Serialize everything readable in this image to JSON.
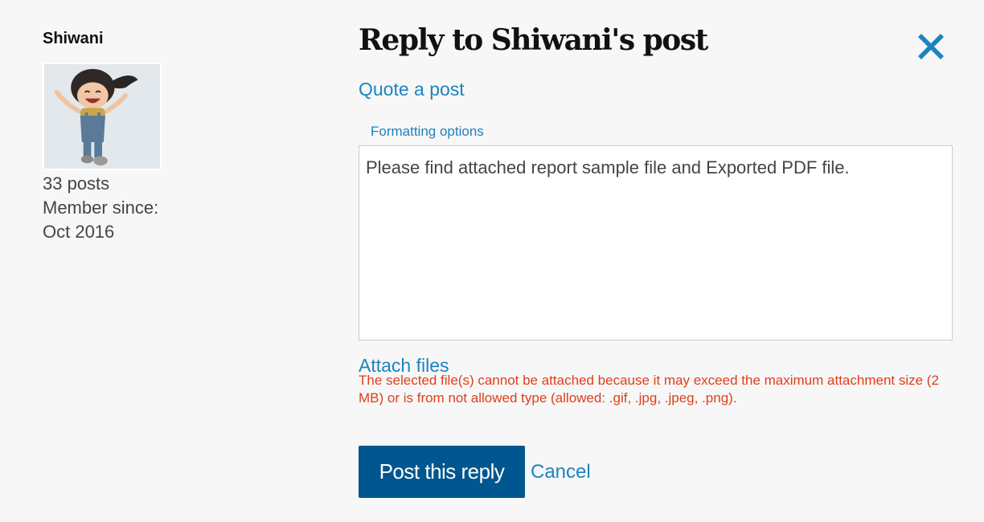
{
  "author": {
    "name": "Shiwani",
    "posts": "33 posts",
    "member_since_label": "Member since:",
    "member_since_date": "Oct 2016",
    "avatar_icon": "cartoon-girl-avatar"
  },
  "reply": {
    "title": "Reply to Shiwani's post",
    "close_icon": "close-icon",
    "quote_link": "Quote a post",
    "formatting_link": "Formatting options",
    "message": "Please find attached report sample file and Exported PDF file.",
    "attach_link": "Attach files",
    "attach_error": "The selected file(s) cannot be attached because it may exceed the maximum attachment size (2 MB) or is from not allowed type (allowed: .gif, .jpg, .jpeg, .png).",
    "post_button": "Post this reply",
    "cancel_link": "Cancel"
  },
  "colors": {
    "background": "#f7f7f7",
    "link": "#1d83c0",
    "primary_button": "#00568f",
    "error": "#e03e1a",
    "close_icon": "#1d83c0"
  }
}
